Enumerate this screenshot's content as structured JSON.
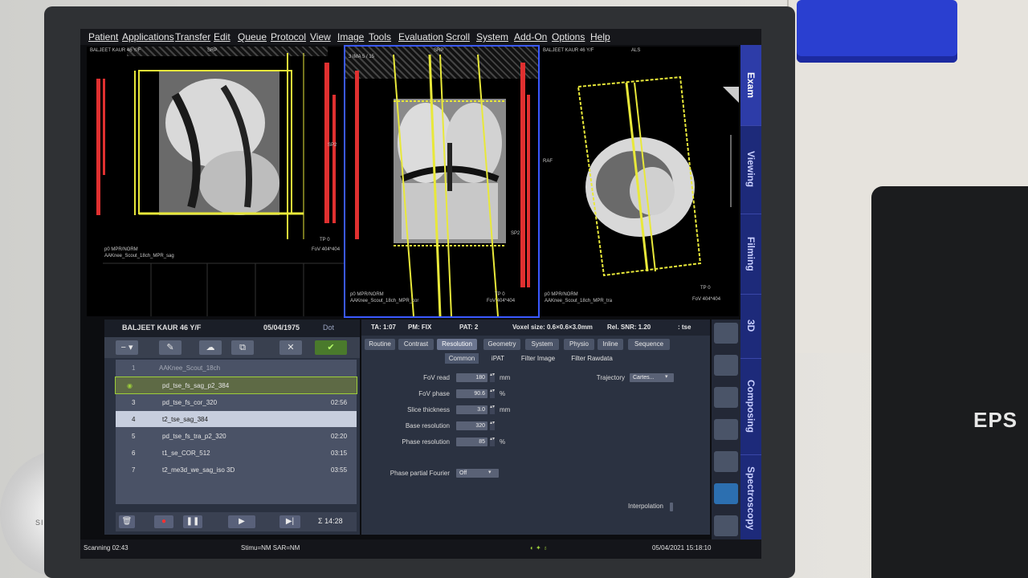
{
  "menu": [
    "Patient",
    "Applications",
    "Transfer",
    "Edit",
    "Queue",
    "Protocol",
    "View",
    "Image",
    "Tools",
    "Evaluation",
    "Scroll",
    "System",
    "Add-On",
    "Options",
    "Help"
  ],
  "right_tabs": [
    "Exam",
    "Viewing",
    "Filming",
    "3D",
    "Composing",
    "Spectroscopy"
  ],
  "viewports": {
    "left": {
      "top_left": "BALJEET KAUR 46 Y/F",
      "bottom_left": "p0 MPR/NORM",
      "bottom_left2": "AAKnee_Scout_18ch_MPR_sag",
      "top_center": "SRP",
      "tp": "TP 0",
      "fov": "FoV 404*404",
      "side_tag": "SP2"
    },
    "center": {
      "top_left": "3 IMA 5 / 15",
      "bottom_left": "p0 MPR/NORM",
      "bottom_left2": "AAKnee_Scout_18ch_MPR_cor",
      "top_center": "SRP",
      "tp": "TP 0",
      "fov": "FoV 404*404",
      "side_tag": "SP2"
    },
    "right": {
      "top_left": "BALJEET KAUR 46 Y/F",
      "bottom_left": "p0 MPR/NORM",
      "bottom_left2": "AAKnee_Scout_18ch_MPR_tra",
      "top_center": "ALS",
      "tp": "TP 0",
      "fov": "FoV 404*404",
      "side_tag": "RAF"
    }
  },
  "patient": {
    "name": "BALJEET KAUR 46 Y/F",
    "dob": "05/04/1975",
    "dot": "Dot"
  },
  "queue": [
    {
      "num": "1",
      "name": "AAKnee_Scout_18ch",
      "time": "",
      "state": "dim"
    },
    {
      "num": "",
      "name": "pd_tse_fs_sag_p2_384",
      "time": "",
      "state": "running"
    },
    {
      "num": "3",
      "name": "pd_tse_fs_cor_320",
      "time": "02:56",
      "state": ""
    },
    {
      "num": "4",
      "name": "t2_tse_sag_384",
      "time": "",
      "state": "selected"
    },
    {
      "num": "5",
      "name": "pd_tse_fs_tra_p2_320",
      "time": "02:20",
      "state": ""
    },
    {
      "num": "6",
      "name": "t1_se_COR_512",
      "time": "03:15",
      "state": ""
    },
    {
      "num": "7",
      "name": "t2_me3d_we_sag_iso 3D",
      "time": "03:55",
      "state": ""
    }
  ],
  "transport": {
    "total_time": "Σ 14:28"
  },
  "protocol_header": {
    "ta": "TA: 1:07",
    "pm": "PM: FIX",
    "pat": "PAT: 2",
    "voxel": "Voxel size: 0.6×0.6×3.0mm",
    "snr": "Rel. SNR: 1.20",
    "type": ": tse"
  },
  "protocol_tabs": [
    "Routine",
    "Contrast",
    "Resolution",
    "Geometry",
    "System",
    "Physio",
    "Inline",
    "Sequence"
  ],
  "protocol_active_tab": "Resolution",
  "sub_tabs": [
    "Common",
    "iPAT",
    "Filter Image",
    "Filter Rawdata"
  ],
  "params": [
    {
      "label": "FoV read",
      "value": "180",
      "unit": "mm"
    },
    {
      "label": "FoV phase",
      "value": "90.6",
      "unit": "%"
    },
    {
      "label": "Slice thickness",
      "value": "3.0",
      "unit": "mm"
    },
    {
      "label": "Base resolution",
      "value": "320",
      "unit": ""
    },
    {
      "label": "Phase resolution",
      "value": "85",
      "unit": "%"
    }
  ],
  "phase_partial_fourier": {
    "label": "Phase partial Fourier",
    "value": "Off"
  },
  "trajectory": {
    "label": "Trajectory",
    "value": "Cartes..."
  },
  "interpolation": {
    "label": "Interpolation"
  },
  "status": {
    "scanning": "Scanning 02:43",
    "stimu": "Stimu=NM SAR=NM",
    "datetime": "05/04/2021 15:18:10"
  },
  "monitor_brand": "SIEMENS",
  "printer_label": "EPS",
  "colors": {
    "accent_yellow": "#e8e83a",
    "marker_red": "#e03030",
    "tab_blue": "#1d2a7a",
    "selection": "#c7cede",
    "running": "#9dcf3a"
  }
}
